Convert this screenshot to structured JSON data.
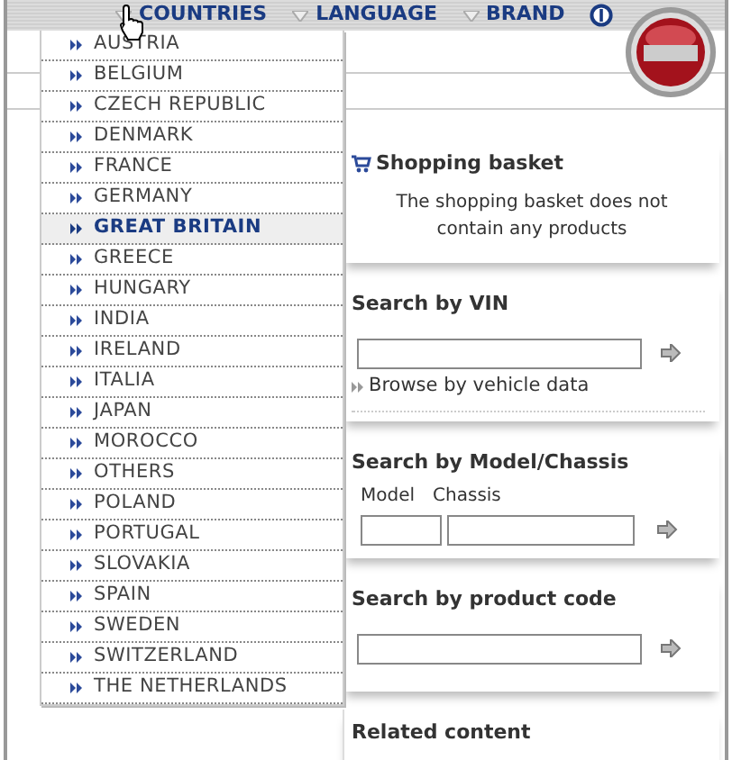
{
  "nav": [
    {
      "label": "COUNTRIES"
    },
    {
      "label": "LANGUAGE"
    },
    {
      "label": "BRAND"
    }
  ],
  "countries": [
    {
      "label": "AUSTRIA",
      "selected": false
    },
    {
      "label": "BELGIUM",
      "selected": false
    },
    {
      "label": "CZECH REPUBLIC",
      "selected": false
    },
    {
      "label": "DENMARK",
      "selected": false
    },
    {
      "label": "FRANCE",
      "selected": false
    },
    {
      "label": "GERMANY",
      "selected": false
    },
    {
      "label": "GREAT BRITAIN",
      "selected": true
    },
    {
      "label": "GREECE",
      "selected": false
    },
    {
      "label": "HUNGARY",
      "selected": false
    },
    {
      "label": "INDIA",
      "selected": false
    },
    {
      "label": "IRELAND",
      "selected": false
    },
    {
      "label": "ITALIA",
      "selected": false
    },
    {
      "label": "JAPAN",
      "selected": false
    },
    {
      "label": "MOROCCO",
      "selected": false
    },
    {
      "label": "OTHERS",
      "selected": false
    },
    {
      "label": "POLAND",
      "selected": false
    },
    {
      "label": "PORTUGAL",
      "selected": false
    },
    {
      "label": "SLOVAKIA",
      "selected": false
    },
    {
      "label": "SPAIN",
      "selected": false
    },
    {
      "label": "SWEDEN",
      "selected": false
    },
    {
      "label": "SWITZERLAND",
      "selected": false
    },
    {
      "label": "THE NETHERLANDS",
      "selected": false
    }
  ],
  "panels": [
    {
      "kind": "basket",
      "title": "Shopping basket",
      "message": "The shopping basket does not contain any products"
    },
    {
      "kind": "vin",
      "title": "Search by VIN",
      "link": "Browse by vehicle data"
    },
    {
      "kind": "model",
      "title": "Search by Model/Chassis",
      "labels": [
        "Model",
        "Chassis"
      ]
    },
    {
      "kind": "code",
      "title": "Search by product code"
    },
    {
      "kind": "related",
      "title": "Related content"
    }
  ]
}
